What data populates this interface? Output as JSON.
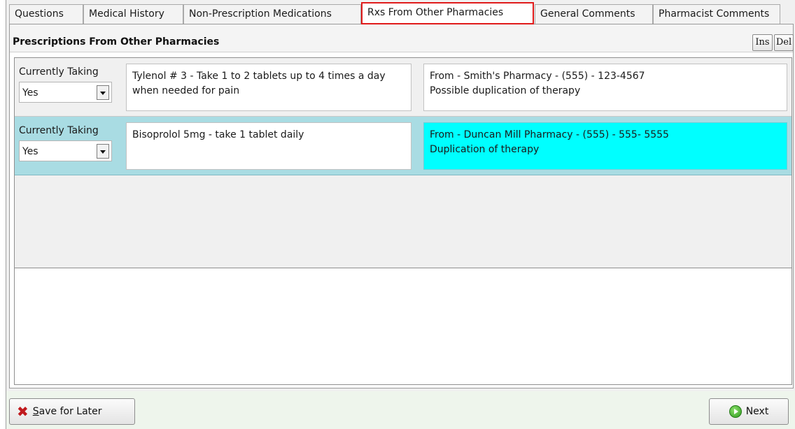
{
  "tabs": [
    {
      "label": "Questions"
    },
    {
      "label": "Medical History"
    },
    {
      "label": "Non-Prescription Medications"
    },
    {
      "label": "Rxs From Other Pharmacies"
    },
    {
      "label": "General Comments"
    },
    {
      "label": "Pharmacist Comments"
    }
  ],
  "active_tab": "Rxs From Other Pharmacies",
  "panel": {
    "title": "Prescriptions From Other Pharmacies",
    "ins_label": "Ins",
    "del_label": "Del"
  },
  "rows": [
    {
      "currently_taking_label": "Currently Taking",
      "currently_taking_value": "Yes",
      "rx_text": "Tylenol # 3 - Take 1 to 2 tablets up to 4 times a day when needed for pain",
      "from_line1": "From - Smith's Pharmacy - (555) - 123-4567",
      "from_line2": "Possible duplication of therapy"
    },
    {
      "currently_taking_label": "Currently Taking",
      "currently_taking_value": "Yes",
      "rx_text": "Bisoprolol 5mg - take 1 tablet daily",
      "from_line1": "From - Duncan Mill Pharmacy - (555) - 555- 5555",
      "from_line2": "Duplication of therapy"
    }
  ],
  "footer": {
    "save_prefix": "",
    "save_mnemonic": "S",
    "save_rest": "ave for Later",
    "next_label": "Next"
  },
  "colors": {
    "active_tab_outline": "#e01b1b",
    "selected_row": "#a9dce3",
    "highlight_cell": "#00ffff"
  },
  "icons": {
    "save": "x-icon",
    "next": "green-arrow-circle-icon",
    "dropdown": "chevron-down-icon"
  }
}
